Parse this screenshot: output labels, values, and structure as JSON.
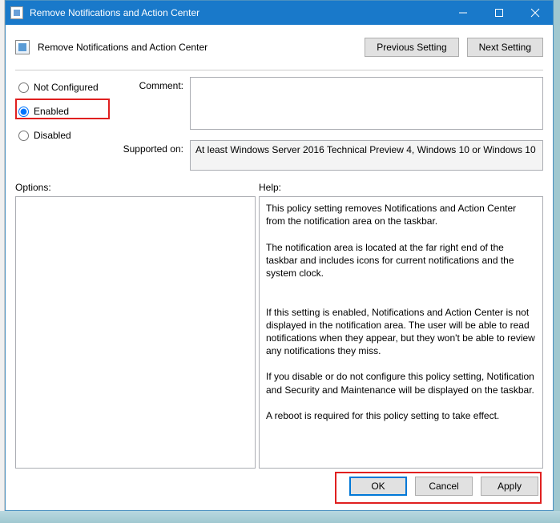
{
  "titlebar": {
    "title": "Remove Notifications and Action Center"
  },
  "header": {
    "policy_name": "Remove Notifications and Action Center",
    "previous": "Previous Setting",
    "next": "Next Setting"
  },
  "state": {
    "options": [
      {
        "label": "Not Configured",
        "checked": false
      },
      {
        "label": "Enabled",
        "checked": true
      },
      {
        "label": "Disabled",
        "checked": false
      }
    ]
  },
  "fields": {
    "comment_label": "Comment:",
    "comment_value": "",
    "supported_label": "Supported on:",
    "supported_value": "At least Windows Server 2016 Technical Preview 4, Windows 10 or Windows 10"
  },
  "panes": {
    "options_label": "Options:",
    "help_label": "Help:",
    "help_text": "This policy setting removes Notifications and Action Center from the notification area on the taskbar.\n\nThe notification area is located at the far right end of the taskbar and includes icons for current notifications and the system clock.\n\n\nIf this setting is enabled, Notifications and Action Center is not displayed in the notification area. The user will be able to read notifications when they appear, but they won't be able to review any notifications they miss.\n\nIf you disable or do not configure this policy setting, Notification and Security and Maintenance will be displayed on the taskbar.\n\nA reboot is required for this policy setting to take effect."
  },
  "footer": {
    "ok": "OK",
    "cancel": "Cancel",
    "apply": "Apply"
  }
}
